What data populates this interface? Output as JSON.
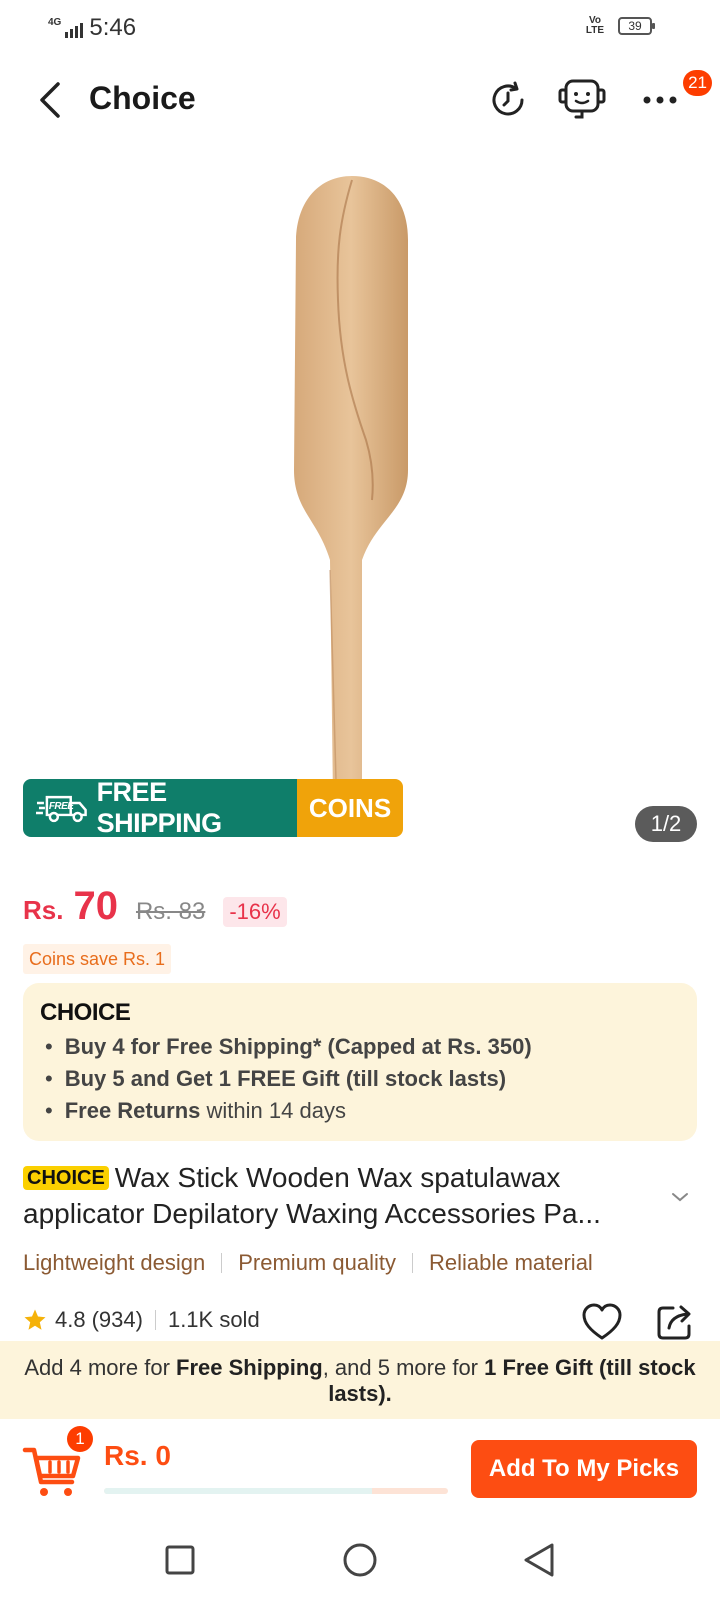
{
  "status_bar": {
    "network": "4G",
    "time": "5:46",
    "volte": "Vo LTE",
    "battery": "39"
  },
  "header": {
    "title": "Choice",
    "more_badge": "21"
  },
  "product_image": {
    "free_shipping_tag": "FREE",
    "free_shipping_label": "FREE SHIPPING",
    "coins_label": "COINS",
    "pager": "1/2"
  },
  "price": {
    "currency": "Rs.",
    "current": "70",
    "original": "Rs. 83",
    "discount": "-16%",
    "coins_save": "Coins save Rs. 1"
  },
  "choice_box": {
    "logo": "CHOICE",
    "benefits": [
      {
        "bold": "Buy 4 for  Free Shipping* (Capped at Rs. 350)",
        "rest": ""
      },
      {
        "bold": "Buy 5 and Get 1 FREE Gift (till stock lasts)",
        "rest": ""
      },
      {
        "bold": "Free Returns",
        "rest": " within 14 days"
      }
    ]
  },
  "product": {
    "choice_tag": "CHOICE",
    "title": "Wax Stick Wooden Wax spatulawax applicator Depilatory Waxing Accessories Pa...",
    "features": [
      "Lightweight design",
      "Premium quality",
      "Reliable material"
    ],
    "rating": "4.8",
    "reviews": "(934)",
    "sold": "1.1K sold"
  },
  "promo": {
    "part1": "Add 4 more for ",
    "bold1": "Free Shipping",
    "part2": ", and 5 more for ",
    "bold2": "1 Free Gift (till stock lasts)."
  },
  "action_bar": {
    "cart_count": "1",
    "cart_total": "Rs. 0",
    "progress_fraction": 0.78,
    "picks_button": "Add To My Picks"
  },
  "colors": {
    "brand_orange": "#fd4d12",
    "price_red": "#e8334a",
    "shipping_green": "#0f7e6a",
    "coins_yellow": "#f0a30a",
    "choice_bg": "#fdf4db"
  },
  "icons": [
    "back-arrow-icon",
    "history-icon",
    "support-robot-icon",
    "more-icon",
    "truck-icon",
    "chevron-down-icon",
    "star-icon",
    "heart-icon",
    "share-icon",
    "cart-icon",
    "square-icon",
    "circle-icon",
    "triangle-back-icon"
  ]
}
